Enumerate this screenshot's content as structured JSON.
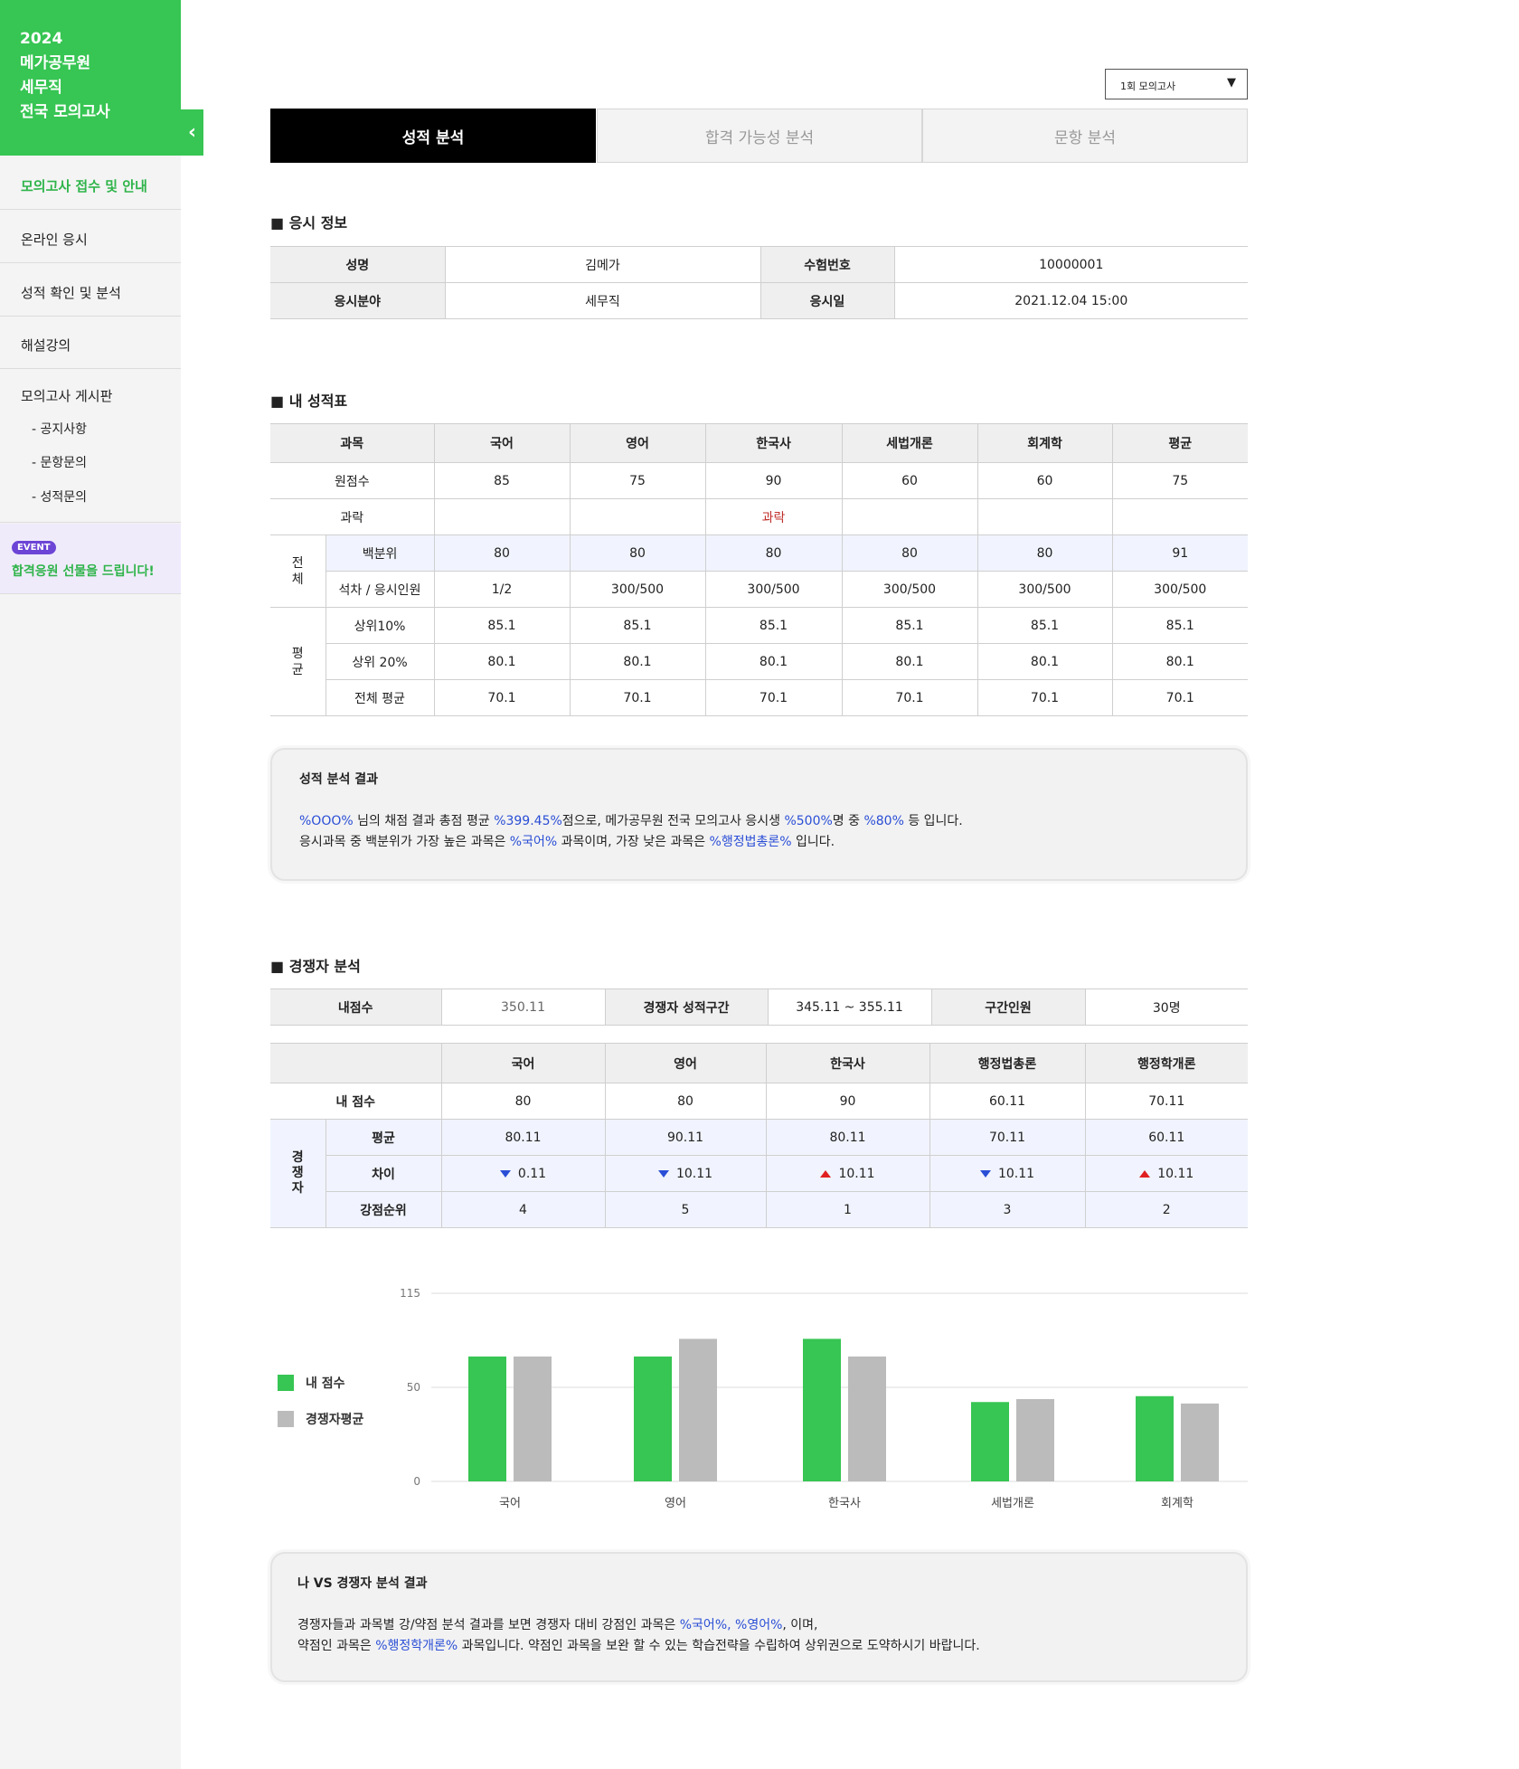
{
  "sidebar": {
    "brand": [
      "2024",
      "메가공무원",
      "세무직",
      "전국 모의고사"
    ],
    "collapse_icon": "chevron-left-icon",
    "items": [
      "모의고사 접수 및 안내",
      "온라인 응시",
      "성적 확인 및 분석",
      "해설강의"
    ],
    "board_title": "모의고사 게시판",
    "board_items": [
      "- 공지사항",
      "- 문항문의",
      "- 성적문의"
    ],
    "event_badge": "EVENT",
    "event_text": "합격응원 선물을 드립니다!"
  },
  "exam_select": {
    "value": "1회 모의고사",
    "arrow": "▼"
  },
  "tabs": [
    "성적 분석",
    "합격 가능성 분석",
    "문항 분석"
  ],
  "exam_info": {
    "title": "응시 정보",
    "name_label": "성명",
    "name": "김메가",
    "number_label": "수험번호",
    "number": "10000001",
    "field_label": "응시분야",
    "field": "세무직",
    "date_label": "응시일",
    "date": "2021.12.04 15:00"
  },
  "scores": {
    "title": "내 성적표",
    "headers": [
      "과목",
      "국어",
      "영어",
      "한국사",
      "세법개론",
      "회계학",
      "평균"
    ],
    "raw_label": "원점수",
    "raw": [
      "85",
      "75",
      "90",
      "60",
      "60",
      "75"
    ],
    "fail_label": "과락",
    "fail": [
      "",
      "",
      "과락",
      "",
      "",
      ""
    ],
    "group_total": "전\n체",
    "percentile_label": "백분위",
    "percentile": [
      "80",
      "80",
      "80",
      "80",
      "80",
      "91"
    ],
    "rank_label": "석차 / 응시인원",
    "rank": [
      "1/2",
      "300/500",
      "300/500",
      "300/500",
      "300/500",
      "300/500"
    ],
    "group_avg": "평\n균",
    "top10_label": "상위10%",
    "top10": [
      "85.1",
      "85.1",
      "85.1",
      "85.1",
      "85.1",
      "85.1"
    ],
    "top20_label": "상위 20%",
    "top20": [
      "80.1",
      "80.1",
      "80.1",
      "80.1",
      "80.1",
      "80.1"
    ],
    "all_label": "전체 평균",
    "all": [
      "70.1",
      "70.1",
      "70.1",
      "70.1",
      "70.1",
      "70.1"
    ]
  },
  "result_box": {
    "title": "성적 분석 결과",
    "l1": [
      "%OOO%",
      " 님의 채점 결과 총점 평균 ",
      "%399.45%",
      "점으로, 메가공무원 전국 모의고사 응시생 ",
      "%500%",
      "명 중 ",
      "%80%",
      " 등 입니다."
    ],
    "l2": [
      "응시과목 중 백분위가 가장 높은 과목은 ",
      "%국어%",
      " 과목이며, 가장 낮은 과목은 ",
      "%행정법총론%",
      " 입니다."
    ]
  },
  "competitor": {
    "title": "경쟁자 분석",
    "my_score_label": "내점수",
    "my_score": "350.11",
    "range_label": "경쟁자 성적구간",
    "range": "345.11 ~ 355.11",
    "count_label": "구간인원",
    "count": "30명",
    "headers": [
      "",
      "국어",
      "영어",
      "한국사",
      "행정법총론",
      "행정학개론"
    ],
    "mine_label": "내 점수",
    "mine": [
      "80",
      "80",
      "90",
      "60.11",
      "70.11"
    ],
    "group": "경\n쟁\n자",
    "avg_label": "평균",
    "avg": [
      "80.11",
      "90.11",
      "80.11",
      "70.11",
      "60.11"
    ],
    "diff_label": "차이",
    "diff": [
      "0.11",
      "10.11",
      "10.11",
      "10.11",
      "10.11"
    ],
    "diff_dir": [
      "down",
      "down",
      "up",
      "down",
      "up"
    ],
    "strength_label": "강점순위",
    "strength": [
      "4",
      "5",
      "1",
      "3",
      "2"
    ]
  },
  "chart_data": {
    "type": "bar",
    "categories": [
      "국어",
      "영어",
      "한국사",
      "세법개론",
      "회계학"
    ],
    "series": [
      {
        "name": "내 점수",
        "values": [
          85,
          85,
          97,
          54,
          58
        ],
        "color": "#37c553"
      },
      {
        "name": "경쟁자평균",
        "values": [
          85,
          97,
          85,
          56,
          53
        ],
        "color": "#bbbbbb"
      }
    ],
    "yticks": [
      "115",
      "50",
      "0"
    ],
    "ylim": [
      0,
      128
    ],
    "grid": true,
    "legend": "left"
  },
  "vs_box": {
    "title": "나 VS 경쟁자 분석 결과",
    "l1": [
      "경쟁자들과 과목별 강/약점 분석 결과를 보면 경쟁자 대비 강점인 과목은 ",
      "%국어%, %영어%",
      ", 이며,"
    ],
    "l2": [
      "약점인 과목은 ",
      "%행정학개론%",
      " 과목입니다. 약점인 과목을 보완 할 수 있는 학습전략을 수립하여 상위권으로 도약하시기 바랍니다."
    ]
  }
}
